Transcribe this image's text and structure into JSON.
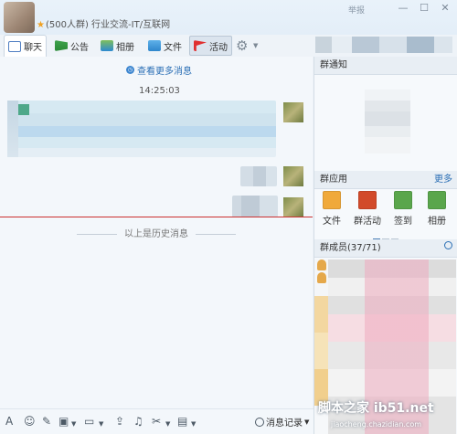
{
  "window": {
    "group_name": "(500人群) 行业交流-IT/互联网",
    "report_label": "举报",
    "minimize": "—",
    "maximize": "☐",
    "close": "✕"
  },
  "tabs": [
    {
      "label": "聊天",
      "icon": "chat-icon"
    },
    {
      "label": "公告",
      "icon": "notice-flag-icon"
    },
    {
      "label": "相册",
      "icon": "album-icon"
    },
    {
      "label": "文件",
      "icon": "folder-icon"
    },
    {
      "label": "活动",
      "icon": "red-flag-icon"
    }
  ],
  "chat": {
    "more_messages": "查看更多消息",
    "timestamp": "14:25:03",
    "history_divider": "以上是历史消息"
  },
  "side": {
    "notice_title": "群通知",
    "apps_title": "群应用",
    "apps_more": "更多",
    "apps": [
      {
        "label": "文件",
        "icon": "file-folder-icon"
      },
      {
        "label": "群活动",
        "icon": "group-activity-icon"
      },
      {
        "label": "签到",
        "icon": "checkin-icon"
      },
      {
        "label": "相册",
        "icon": "photo-album-icon"
      }
    ],
    "members_title": "群成员(37/71)"
  },
  "toolbar": {
    "font": "A",
    "emoji": "☺",
    "history_label": "消息记录"
  },
  "watermark": {
    "line1": "脚本之家 ib51.net",
    "line2": "jiaocheng.chazidian.com"
  },
  "colors": {
    "accent": "#2b6fb5",
    "divider_red": "#cc3030"
  }
}
